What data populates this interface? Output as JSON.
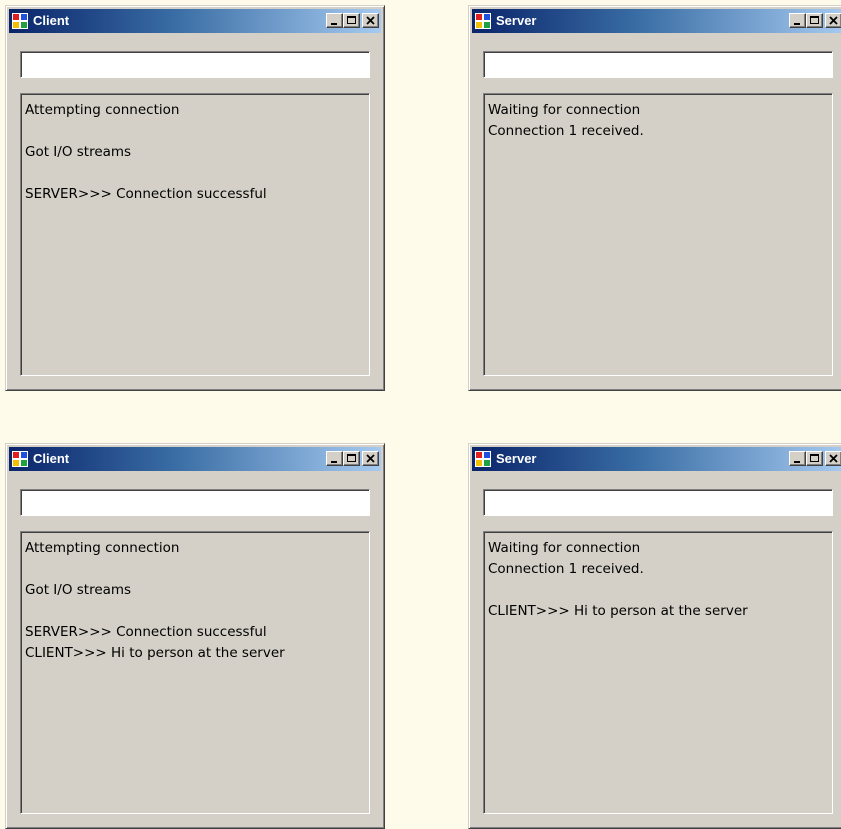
{
  "windows": [
    {
      "title": "Client",
      "input_value": "",
      "output_text": "Attempting connection\n\nGot I/O streams\n\nSERVER>>> Connection successful"
    },
    {
      "title": "Server",
      "input_value": "",
      "output_text": "Waiting for connection\nConnection 1 received."
    },
    {
      "title": "Client",
      "input_value": "",
      "output_text": "Attempting connection\n\nGot I/O streams\n\nSERVER>>> Connection successful\nCLIENT>>> Hi to person at the server"
    },
    {
      "title": "Server",
      "input_value": "",
      "output_text": "Waiting for connection\nConnection 1 received.\n\nCLIENT>>> Hi to person at the server"
    }
  ],
  "icons": {
    "app": "application-icon",
    "minimize": "minimize-icon",
    "maximize": "maximize-icon",
    "close": "close-icon"
  },
  "colors": {
    "background": "#fefbea",
    "title_active_start": "#0a246a",
    "title_active_end": "#a6caf0",
    "face": "#d4d0c8"
  }
}
